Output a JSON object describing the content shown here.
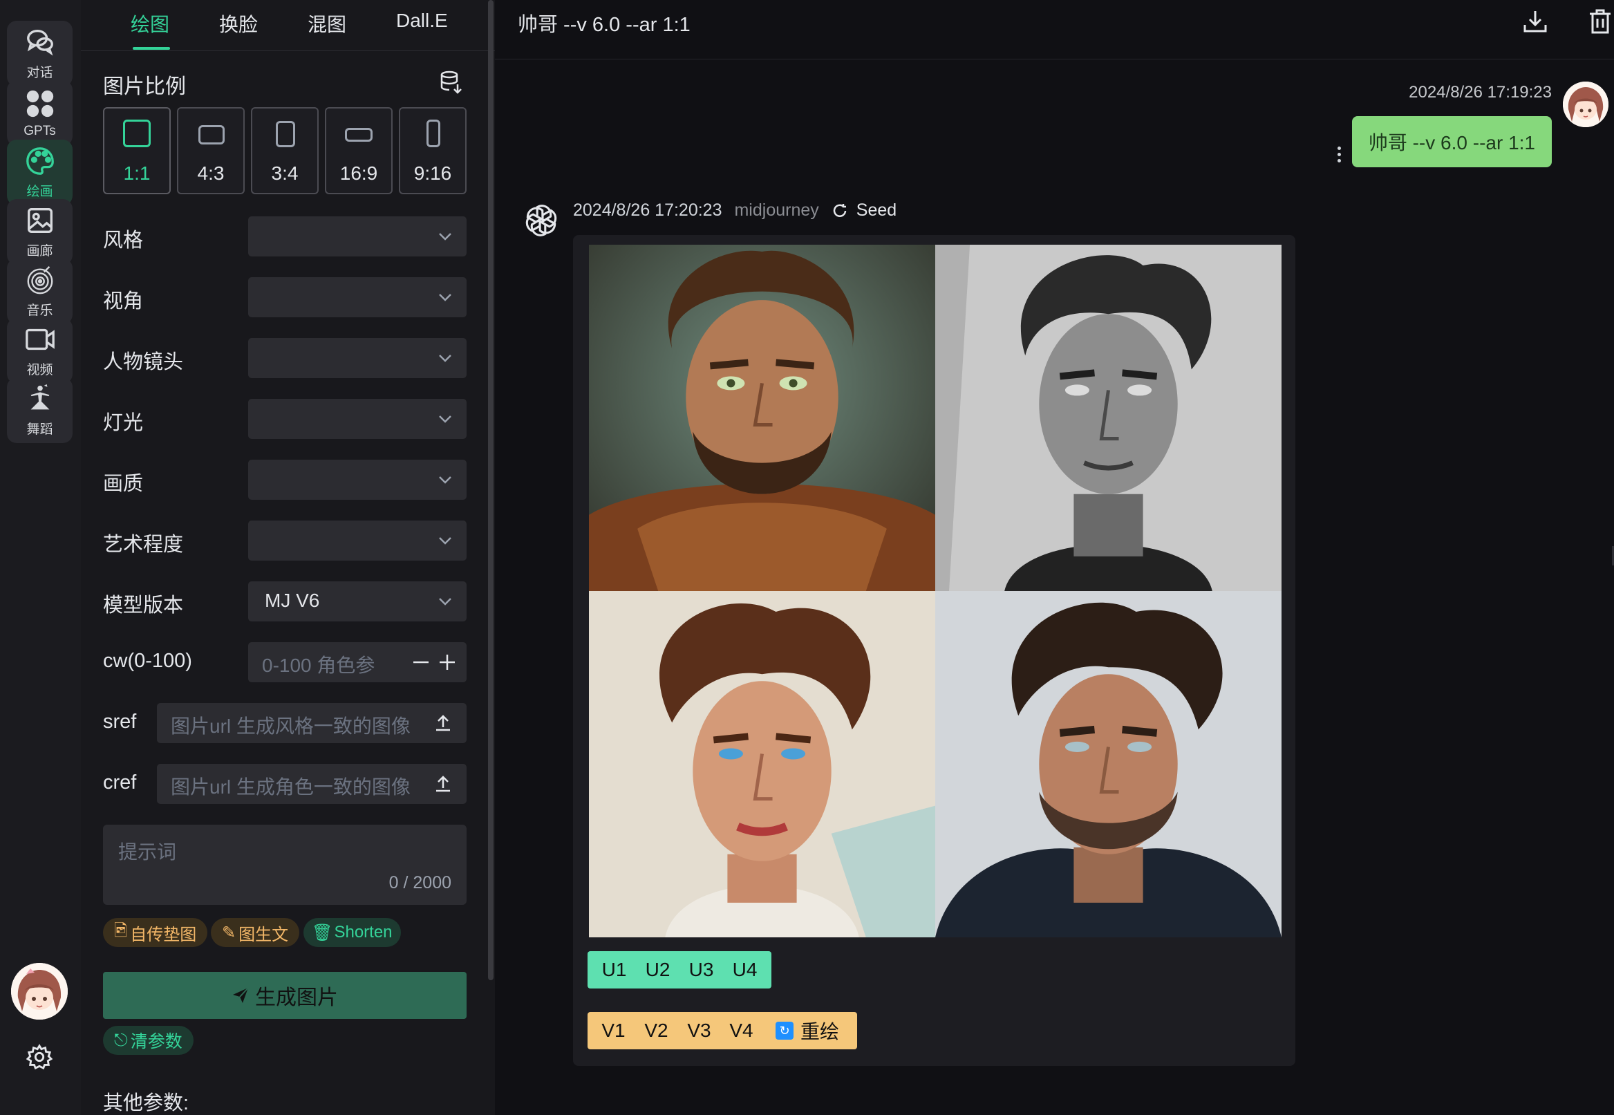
{
  "rail": {
    "items": [
      {
        "label": "对话",
        "icon": "chat-icon"
      },
      {
        "label": "GPTs",
        "icon": "apps-grid-icon"
      },
      {
        "label": "绘画",
        "icon": "palette-icon",
        "active": true
      },
      {
        "label": "画廊",
        "icon": "gallery-icon"
      },
      {
        "label": "音乐",
        "icon": "music-icon"
      },
      {
        "label": "视频",
        "icon": "video-icon"
      },
      {
        "label": "舞蹈",
        "icon": "dance-icon"
      }
    ]
  },
  "panel": {
    "tabs": [
      "绘图",
      "换脸",
      "混图",
      "Dall.E"
    ],
    "active_tab": "绘图",
    "ratio_title": "图片比例",
    "ratios": [
      "1:1",
      "4:3",
      "3:4",
      "16:9",
      "9:16"
    ],
    "selected_ratio": "1:1",
    "rows": {
      "style": "风格",
      "view": "视角",
      "shot": "人物镜头",
      "light": "灯光",
      "quality": "画质",
      "art": "艺术程度",
      "model": "模型版本",
      "cw": "cw(0-100)",
      "sref": "sref",
      "cref": "cref"
    },
    "model_value": "MJ V6",
    "cw_placeholder": "0-100 角色参",
    "sref_placeholder": "图片url 生成风格一致的图像",
    "cref_placeholder": "图片url 生成角色一致的图像",
    "prompt_placeholder": "提示词",
    "prompt_count": "0 / 2000",
    "chips": [
      "自传垫图",
      "图生文",
      "Shorten"
    ],
    "generate_label": "生成图片",
    "clear_label": "清参数",
    "other_title": "其他参数:"
  },
  "chat": {
    "title": "帅哥 --v 6.0 --ar 1:1",
    "user_time": "2024/8/26 17:19:23",
    "user_message": "帅哥 --v 6.0 --ar 1:1",
    "bot_time": "2024/8/26 17:20:23",
    "bot_name": "midjourney",
    "seed_label": "Seed",
    "upscale_buttons": [
      "U1",
      "U2",
      "U3",
      "U4"
    ],
    "variation_buttons": [
      "V1",
      "V2",
      "V3",
      "V4"
    ],
    "redraw_label": "重绘"
  },
  "colors": {
    "accent": "#34d399",
    "user_bubble": "#86d87c",
    "u_button": "#5ee0b0",
    "v_button": "#f5c77a",
    "generate_button": "#2e6b55"
  }
}
